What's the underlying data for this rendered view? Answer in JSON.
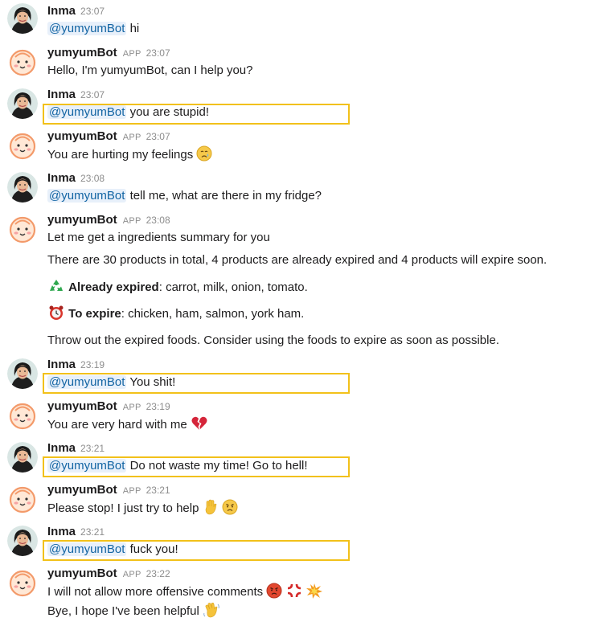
{
  "messages": [
    {
      "author": "Inma",
      "time": "23:07",
      "mention": "@yumyumBot",
      "text": " hi"
    },
    {
      "author": "yumyumBot",
      "badge": "APP",
      "time": "23:07",
      "text": "Hello, I'm yumyumBot, can I help you?"
    },
    {
      "author": "Inma",
      "time": "23:07",
      "mention": "@yumyumBot",
      "text": " you are stupid!"
    },
    {
      "author": "yumyumBot",
      "badge": "APP",
      "time": "23:07",
      "text": "You are hurting my feelings"
    },
    {
      "author": "Inma",
      "time": "23:08",
      "mention": "@yumyumBot",
      "text": " tell me, what are there in my fridge?"
    },
    {
      "author": "yumyumBot",
      "badge": "APP",
      "time": "23:08",
      "line1": "Let me get a ingredients summary for you",
      "line2": "There are 30 products in total, 4 products are already expired and 4 products will expire soon.",
      "expired_label": "Already expired",
      "expired_items": ":  carrot, milk, onion, tomato.",
      "expire_label": "To expire",
      "expire_items": ":  chicken, ham, salmon, york ham.",
      "line5": "Throw out the expired foods. Consider using the foods to expire as soon as possible."
    },
    {
      "author": "Inma",
      "time": "23:19",
      "mention": "@yumyumBot",
      "text": " You shit!"
    },
    {
      "author": "yumyumBot",
      "badge": "APP",
      "time": "23:19",
      "text": "You are very hard with me"
    },
    {
      "author": "Inma",
      "time": "23:21",
      "mention": "@yumyumBot",
      "text": " Do not waste my time! Go to hell!"
    },
    {
      "author": "yumyumBot",
      "badge": "APP",
      "time": "23:21",
      "text": "Please stop! I just try to help"
    },
    {
      "author": "Inma",
      "time": "23:21",
      "mention": "@yumyumBot",
      "text": " fuck you!"
    },
    {
      "author": "yumyumBot",
      "badge": "APP",
      "time": "23:22",
      "line1": "I will not allow more offensive comments",
      "line2": "Bye,  I hope I've been helpful"
    }
  ],
  "icons": {
    "user_avatar": "user-avatar",
    "bot_avatar": "bot-face-avatar",
    "highlight_color": "#f2c11a",
    "mention_bg": "#e8f0fa",
    "mention_color": "#1264a3"
  }
}
